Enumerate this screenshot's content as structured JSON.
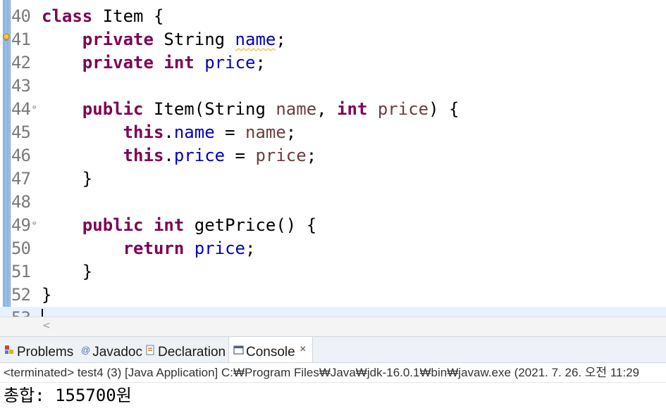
{
  "editor": {
    "lines": [
      {
        "num": "40",
        "fold": "",
        "tokens": [
          {
            "t": "class",
            "c": "kw"
          },
          {
            "t": " Item {",
            "c": ""
          }
        ]
      },
      {
        "num": "41",
        "fold": "",
        "tokens": [
          {
            "t": "    ",
            "c": ""
          },
          {
            "t": "private",
            "c": "kw"
          },
          {
            "t": " String ",
            "c": ""
          },
          {
            "t": "name",
            "c": "fld warn-underline"
          },
          {
            "t": ";",
            "c": ""
          }
        ]
      },
      {
        "num": "42",
        "fold": "",
        "tokens": [
          {
            "t": "    ",
            "c": ""
          },
          {
            "t": "private",
            "c": "kw"
          },
          {
            "t": " ",
            "c": ""
          },
          {
            "t": "int",
            "c": "kw"
          },
          {
            "t": " ",
            "c": ""
          },
          {
            "t": "price",
            "c": "fld"
          },
          {
            "t": ";",
            "c": ""
          }
        ]
      },
      {
        "num": "43",
        "fold": "",
        "tokens": []
      },
      {
        "num": "44",
        "fold": "⊖",
        "tokens": [
          {
            "t": "    ",
            "c": ""
          },
          {
            "t": "public",
            "c": "kw"
          },
          {
            "t": " Item(String ",
            "c": ""
          },
          {
            "t": "name",
            "c": "prm"
          },
          {
            "t": ", ",
            "c": ""
          },
          {
            "t": "int",
            "c": "kw"
          },
          {
            "t": " ",
            "c": ""
          },
          {
            "t": "price",
            "c": "prm"
          },
          {
            "t": ") {",
            "c": ""
          }
        ]
      },
      {
        "num": "45",
        "fold": "",
        "tokens": [
          {
            "t": "        ",
            "c": ""
          },
          {
            "t": "this",
            "c": "kw"
          },
          {
            "t": ".",
            "c": ""
          },
          {
            "t": "name",
            "c": "fld"
          },
          {
            "t": " = ",
            "c": ""
          },
          {
            "t": "name",
            "c": "prm"
          },
          {
            "t": ";",
            "c": ""
          }
        ]
      },
      {
        "num": "46",
        "fold": "",
        "tokens": [
          {
            "t": "        ",
            "c": ""
          },
          {
            "t": "this",
            "c": "kw"
          },
          {
            "t": ".",
            "c": ""
          },
          {
            "t": "price",
            "c": "fld"
          },
          {
            "t": " = ",
            "c": ""
          },
          {
            "t": "price",
            "c": "prm"
          },
          {
            "t": ";",
            "c": ""
          }
        ]
      },
      {
        "num": "47",
        "fold": "",
        "tokens": [
          {
            "t": "    }",
            "c": ""
          }
        ]
      },
      {
        "num": "48",
        "fold": "",
        "tokens": []
      },
      {
        "num": "49",
        "fold": "⊖",
        "tokens": [
          {
            "t": "    ",
            "c": ""
          },
          {
            "t": "public",
            "c": "kw"
          },
          {
            "t": " ",
            "c": ""
          },
          {
            "t": "int",
            "c": "kw"
          },
          {
            "t": " getPrice() {",
            "c": ""
          }
        ]
      },
      {
        "num": "50",
        "fold": "",
        "tokens": [
          {
            "t": "        ",
            "c": ""
          },
          {
            "t": "return",
            "c": "kw"
          },
          {
            "t": " ",
            "c": ""
          },
          {
            "t": "price",
            "c": "fld"
          },
          {
            "t": ";",
            "c": ""
          }
        ]
      },
      {
        "num": "51",
        "fold": "",
        "tokens": [
          {
            "t": "    }",
            "c": ""
          }
        ]
      },
      {
        "num": "52",
        "fold": "",
        "tokens": [
          {
            "t": "}",
            "c": ""
          }
        ]
      },
      {
        "num": "53",
        "fold": "",
        "tokens": [],
        "current": true
      }
    ],
    "warning_icon": "warning-lightbulb-icon"
  },
  "scrollbar": {
    "left_arrow": "<"
  },
  "views": {
    "tabs": [
      {
        "label": "Problems",
        "icon": "problems-icon"
      },
      {
        "label": "Javadoc",
        "icon": "javadoc-icon",
        "glyph": "@"
      },
      {
        "label": "Declaration",
        "icon": "declaration-icon"
      },
      {
        "label": "Console",
        "icon": "console-icon",
        "active": true,
        "close": "✕"
      }
    ]
  },
  "console": {
    "description": "<terminated> test4 (3) [Java Application] C:₩Program Files₩Java₩jdk-16.0.1₩bin₩javaw.exe  (2021. 7. 26. 오전 11:29",
    "output": "총합: 155700원"
  },
  "colors": {
    "keyword": "#7f0055",
    "field": "#0000c0",
    "parameter": "#6a3e3e",
    "current_line": "#e8f2fe"
  }
}
